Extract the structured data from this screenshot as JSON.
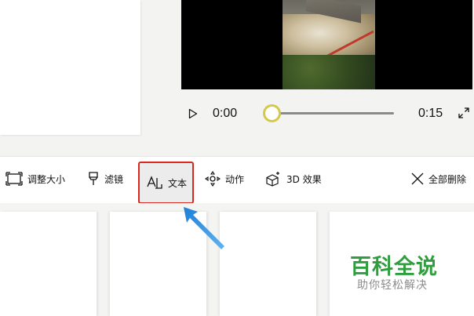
{
  "player": {
    "current_time": "0:00",
    "total_time": "0:15",
    "progress": 0
  },
  "toolbar": {
    "resize_label": "调整大小",
    "filter_label": "滤镜",
    "text_label": "文本",
    "motion_label": "动作",
    "effect3d_label": "3D 效果",
    "remove_all_label": "全部删除"
  },
  "watermark": {
    "title": "百科全说",
    "subtitle": "助你轻松解决"
  },
  "colors": {
    "highlight_box": "#d9281f",
    "annotation_arrow": "#2f8fe0",
    "slider_thumb": "#d4c94a",
    "watermark_green": "#2e9e3e"
  },
  "icons": {
    "play": "play-icon",
    "expand": "expand-icon",
    "resize": "resize-icon",
    "filter": "filter-icon",
    "text": "text-icon",
    "motion": "motion-icon",
    "effect3d": "3d-effect-icon",
    "remove_all": "close-icon"
  }
}
